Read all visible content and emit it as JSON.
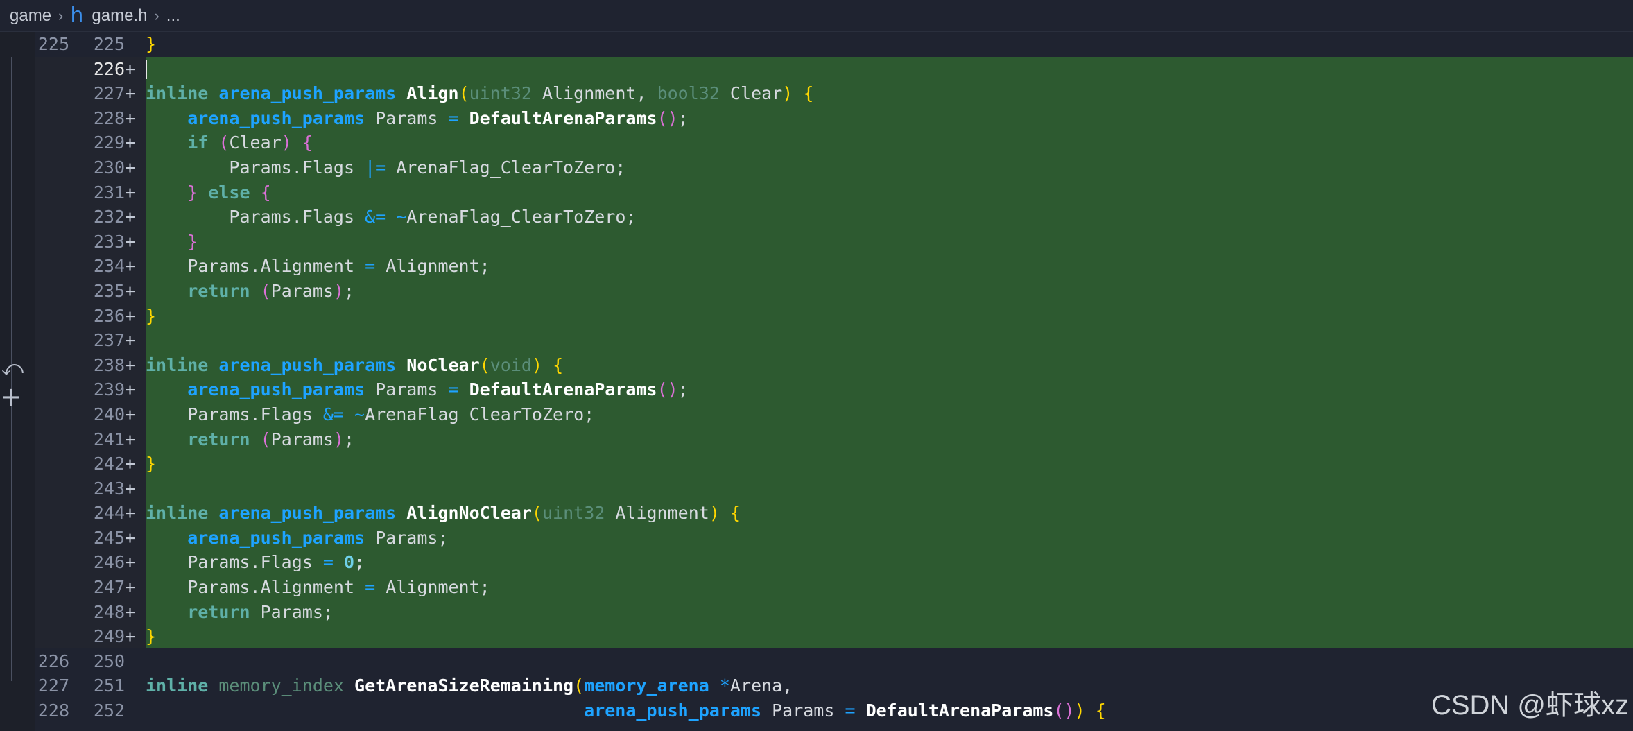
{
  "breadcrumb": {
    "folder": "game",
    "icon": "h",
    "file": "game.h",
    "more": "..."
  },
  "watermark": "CSDN @虾球xz",
  "colors": {
    "added_bg": "#2d5a30",
    "editor_bg": "#1f2330",
    "type": "#1ea3ff",
    "keyword": "#5fb0a8"
  },
  "lines": [
    {
      "old": "225",
      "new": "225",
      "marker": "",
      "added": false,
      "tokens": [
        {
          "t": "}",
          "c": "b1"
        }
      ]
    },
    {
      "old": "",
      "new": "226",
      "marker": "+",
      "added": true,
      "caret": true,
      "tokens": []
    },
    {
      "old": "",
      "new": "227",
      "marker": "+",
      "added": true,
      "tokens": [
        {
          "t": "inline ",
          "c": "kw"
        },
        {
          "t": "arena_push_params ",
          "c": "ty"
        },
        {
          "t": "Align",
          "c": "fn"
        },
        {
          "t": "(",
          "c": "b1"
        },
        {
          "t": "uint32 ",
          "c": "pt"
        },
        {
          "t": "Alignment, "
        },
        {
          "t": "bool32 ",
          "c": "pt"
        },
        {
          "t": "Clear"
        },
        {
          "t": ")",
          "c": "b1"
        },
        {
          "t": " "
        },
        {
          "t": "{",
          "c": "b1"
        }
      ]
    },
    {
      "old": "",
      "new": "228",
      "marker": "+",
      "added": true,
      "tokens": [
        {
          "t": "    "
        },
        {
          "t": "arena_push_params ",
          "c": "ty"
        },
        {
          "t": "Params "
        },
        {
          "t": "= ",
          "c": "op"
        },
        {
          "t": "DefaultArenaParams",
          "c": "fn"
        },
        {
          "t": "()",
          "c": "b2"
        },
        {
          "t": ";"
        }
      ]
    },
    {
      "old": "",
      "new": "229",
      "marker": "+",
      "added": true,
      "tokens": [
        {
          "t": "    "
        },
        {
          "t": "if ",
          "c": "kw"
        },
        {
          "t": "(",
          "c": "b2"
        },
        {
          "t": "Clear"
        },
        {
          "t": ")",
          "c": "b2"
        },
        {
          "t": " "
        },
        {
          "t": "{",
          "c": "b2"
        }
      ]
    },
    {
      "old": "",
      "new": "230",
      "marker": "+",
      "added": true,
      "tokens": [
        {
          "t": "        Params.Flags "
        },
        {
          "t": "|= ",
          "c": "op"
        },
        {
          "t": "ArenaFlag_ClearToZero;"
        }
      ]
    },
    {
      "old": "",
      "new": "231",
      "marker": "+",
      "added": true,
      "tokens": [
        {
          "t": "    "
        },
        {
          "t": "} ",
          "c": "b2"
        },
        {
          "t": "else ",
          "c": "kw"
        },
        {
          "t": "{",
          "c": "b2"
        }
      ]
    },
    {
      "old": "",
      "new": "232",
      "marker": "+",
      "added": true,
      "tokens": [
        {
          "t": "        Params.Flags "
        },
        {
          "t": "&= ~",
          "c": "op"
        },
        {
          "t": "ArenaFlag_ClearToZero;"
        }
      ]
    },
    {
      "old": "",
      "new": "233",
      "marker": "+",
      "added": true,
      "tokens": [
        {
          "t": "    "
        },
        {
          "t": "}",
          "c": "b2"
        }
      ]
    },
    {
      "old": "",
      "new": "234",
      "marker": "+",
      "added": true,
      "tokens": [
        {
          "t": "    Params.Alignment "
        },
        {
          "t": "= ",
          "c": "op"
        },
        {
          "t": "Alignment;"
        }
      ]
    },
    {
      "old": "",
      "new": "235",
      "marker": "+",
      "added": true,
      "tokens": [
        {
          "t": "    "
        },
        {
          "t": "return ",
          "c": "kw"
        },
        {
          "t": "(",
          "c": "b2"
        },
        {
          "t": "Params"
        },
        {
          "t": ")",
          "c": "b2"
        },
        {
          "t": ";"
        }
      ]
    },
    {
      "old": "",
      "new": "236",
      "marker": "+",
      "added": true,
      "tokens": [
        {
          "t": "}",
          "c": "b1"
        }
      ]
    },
    {
      "old": "",
      "new": "237",
      "marker": "+",
      "added": true,
      "tokens": []
    },
    {
      "old": "",
      "new": "238",
      "marker": "+",
      "added": true,
      "tokens": [
        {
          "t": "inline ",
          "c": "kw"
        },
        {
          "t": "arena_push_params ",
          "c": "ty"
        },
        {
          "t": "NoClear",
          "c": "fn"
        },
        {
          "t": "(",
          "c": "b1"
        },
        {
          "t": "void",
          "c": "pt"
        },
        {
          "t": ")",
          "c": "b1"
        },
        {
          "t": " "
        },
        {
          "t": "{",
          "c": "b1"
        }
      ]
    },
    {
      "old": "",
      "new": "239",
      "marker": "+",
      "added": true,
      "tokens": [
        {
          "t": "    "
        },
        {
          "t": "arena_push_params ",
          "c": "ty"
        },
        {
          "t": "Params "
        },
        {
          "t": "= ",
          "c": "op"
        },
        {
          "t": "DefaultArenaParams",
          "c": "fn"
        },
        {
          "t": "()",
          "c": "b2"
        },
        {
          "t": ";"
        }
      ]
    },
    {
      "old": "",
      "new": "240",
      "marker": "+",
      "added": true,
      "tokens": [
        {
          "t": "    Params.Flags "
        },
        {
          "t": "&= ~",
          "c": "op"
        },
        {
          "t": "ArenaFlag_ClearToZero;"
        }
      ]
    },
    {
      "old": "",
      "new": "241",
      "marker": "+",
      "added": true,
      "tokens": [
        {
          "t": "    "
        },
        {
          "t": "return ",
          "c": "kw"
        },
        {
          "t": "(",
          "c": "b2"
        },
        {
          "t": "Params"
        },
        {
          "t": ")",
          "c": "b2"
        },
        {
          "t": ";"
        }
      ]
    },
    {
      "old": "",
      "new": "242",
      "marker": "+",
      "added": true,
      "tokens": [
        {
          "t": "}",
          "c": "b1"
        }
      ]
    },
    {
      "old": "",
      "new": "243",
      "marker": "+",
      "added": true,
      "tokens": []
    },
    {
      "old": "",
      "new": "244",
      "marker": "+",
      "added": true,
      "tokens": [
        {
          "t": "inline ",
          "c": "kw"
        },
        {
          "t": "arena_push_params ",
          "c": "ty"
        },
        {
          "t": "AlignNoClear",
          "c": "fn"
        },
        {
          "t": "(",
          "c": "b1"
        },
        {
          "t": "uint32 ",
          "c": "pt"
        },
        {
          "t": "Alignment"
        },
        {
          "t": ")",
          "c": "b1"
        },
        {
          "t": " "
        },
        {
          "t": "{",
          "c": "b1"
        }
      ]
    },
    {
      "old": "",
      "new": "245",
      "marker": "+",
      "added": true,
      "tokens": [
        {
          "t": "    "
        },
        {
          "t": "arena_push_params ",
          "c": "ty"
        },
        {
          "t": "Params;"
        }
      ]
    },
    {
      "old": "",
      "new": "246",
      "marker": "+",
      "added": true,
      "tokens": [
        {
          "t": "    Params.Flags "
        },
        {
          "t": "= ",
          "c": "op"
        },
        {
          "t": "0",
          "c": "num"
        },
        {
          "t": ";"
        }
      ]
    },
    {
      "old": "",
      "new": "247",
      "marker": "+",
      "added": true,
      "tokens": [
        {
          "t": "    Params.Alignment "
        },
        {
          "t": "= ",
          "c": "op"
        },
        {
          "t": "Alignment;"
        }
      ]
    },
    {
      "old": "",
      "new": "248",
      "marker": "+",
      "added": true,
      "tokens": [
        {
          "t": "    "
        },
        {
          "t": "return ",
          "c": "kw"
        },
        {
          "t": "Params;"
        }
      ]
    },
    {
      "old": "",
      "new": "249",
      "marker": "+",
      "added": true,
      "tokens": [
        {
          "t": "}",
          "c": "b1"
        }
      ]
    },
    {
      "old": "226",
      "new": "250",
      "marker": "",
      "added": false,
      "tokens": []
    },
    {
      "old": "227",
      "new": "251",
      "marker": "",
      "added": false,
      "tokens": [
        {
          "t": "inline ",
          "c": "kw"
        },
        {
          "t": "memory_index ",
          "c": "pt"
        },
        {
          "t": "GetArenaSizeRemaining",
          "c": "fn"
        },
        {
          "t": "(",
          "c": "b1"
        },
        {
          "t": "memory_arena ",
          "c": "ty"
        },
        {
          "t": "*",
          "c": "op"
        },
        {
          "t": "Arena,"
        }
      ]
    },
    {
      "old": "228",
      "new": "252",
      "marker": "",
      "added": false,
      "tokens": [
        {
          "t": "                                          "
        },
        {
          "t": "arena_push_params ",
          "c": "ty"
        },
        {
          "t": "Params "
        },
        {
          "t": "= ",
          "c": "op"
        },
        {
          "t": "DefaultArenaParams",
          "c": "fn"
        },
        {
          "t": "()",
          "c": "b2"
        },
        {
          "t": ")",
          "c": "b1"
        },
        {
          "t": " "
        },
        {
          "t": "{",
          "c": "b1"
        }
      ]
    }
  ]
}
